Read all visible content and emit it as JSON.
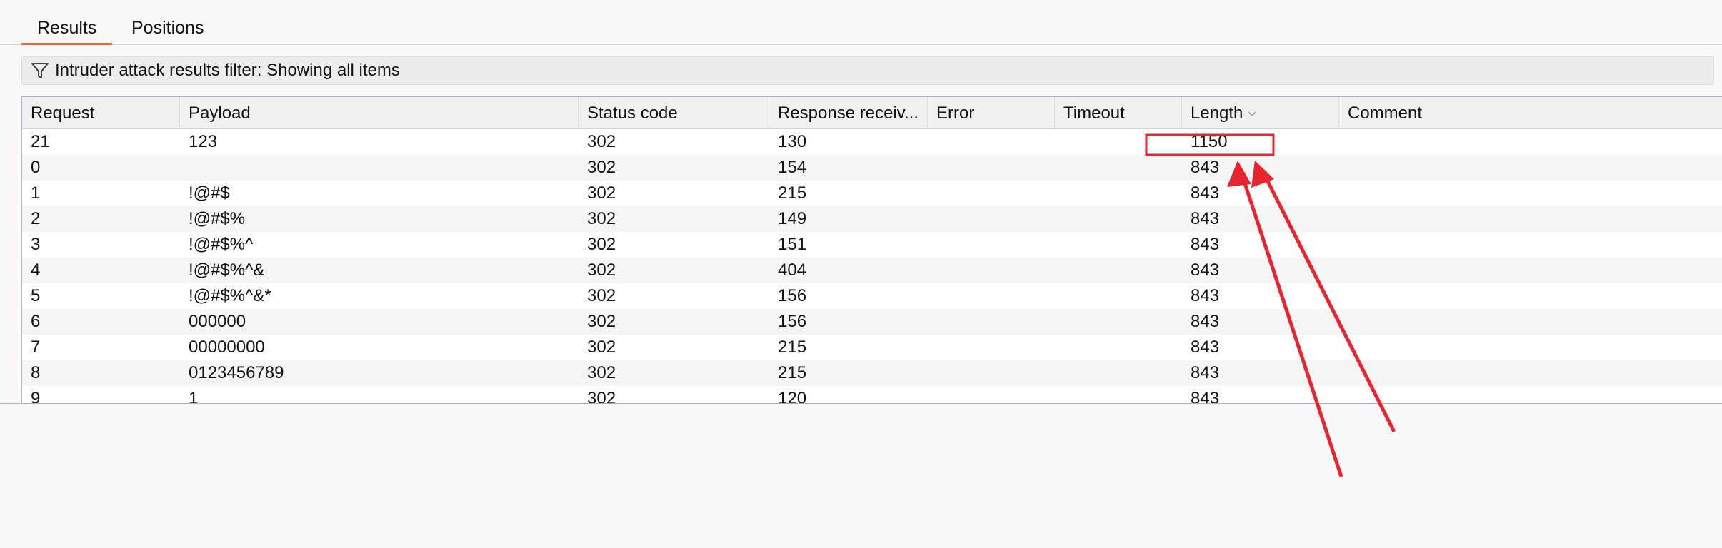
{
  "tabs": [
    {
      "label": "Results",
      "active": true
    },
    {
      "label": "Positions",
      "active": false
    }
  ],
  "filter": {
    "icon": "filter-icon",
    "text": "Intruder attack results filter: Showing all items"
  },
  "table": {
    "columns": [
      "Request",
      "Payload",
      "Status code",
      "Response receiv...",
      "Error",
      "Timeout",
      "Length",
      "Comment"
    ],
    "sorted_column": "Length",
    "rows": [
      [
        "21",
        "123",
        "302",
        "130",
        "",
        "",
        "1150",
        ""
      ],
      [
        "0",
        "",
        "302",
        "154",
        "",
        "",
        "843",
        ""
      ],
      [
        "1",
        "!@#$",
        "302",
        "215",
        "",
        "",
        "843",
        ""
      ],
      [
        "2",
        "!@#$%",
        "302",
        "149",
        "",
        "",
        "843",
        ""
      ],
      [
        "3",
        "!@#$%^",
        "302",
        "151",
        "",
        "",
        "843",
        ""
      ],
      [
        "4",
        "!@#$%^&",
        "302",
        "404",
        "",
        "",
        "843",
        ""
      ],
      [
        "5",
        "!@#$%^&*",
        "302",
        "156",
        "",
        "",
        "843",
        ""
      ],
      [
        "6",
        "000000",
        "302",
        "156",
        "",
        "",
        "843",
        ""
      ],
      [
        "7",
        "00000000",
        "302",
        "215",
        "",
        "",
        "843",
        ""
      ],
      [
        "8",
        "0123456789",
        "302",
        "215",
        "",
        "",
        "843",
        ""
      ],
      [
        "9",
        "1",
        "302",
        "120",
        "",
        "",
        "843",
        ""
      ]
    ]
  },
  "annotation": {
    "color": "#e8252e"
  },
  "colors": {
    "tab_accent": "#e8643a",
    "table_border": "#9fb5cf"
  }
}
